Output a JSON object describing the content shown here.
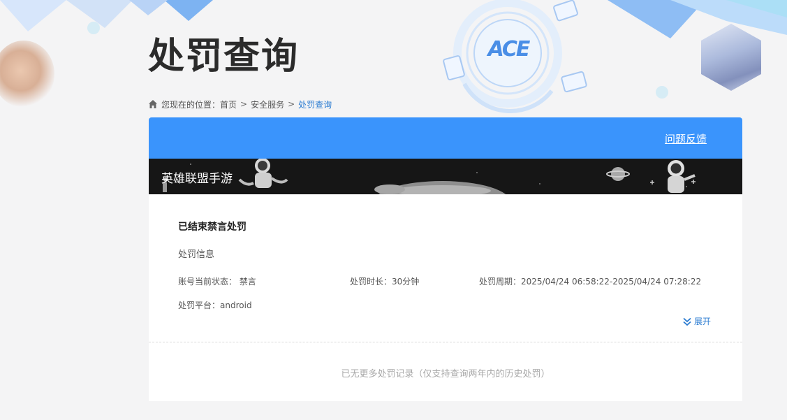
{
  "header": {
    "logo_text": "ACE",
    "title": "处罚查询"
  },
  "breadcrumb": {
    "prefix": "您现在的位置：",
    "items": [
      "首页",
      "安全服务"
    ],
    "separator": ">",
    "current": "处罚查询"
  },
  "card": {
    "feedback_label": "问题反馈",
    "game_name": "英雄联盟手游",
    "record": {
      "title": "已结束禁言处罚",
      "section_label": "处罚信息",
      "status_label": "账号当前状态：",
      "status_value": "禁言",
      "duration_label": "处罚时长：",
      "duration_value": "30分钟",
      "period_label": "处罚周期：",
      "period_value": "2025/04/24 06:58:22-2025/04/24 07:28:22",
      "platform_label": "处罚平台：",
      "platform_value": "android",
      "expand_label": "展开"
    },
    "no_more_text": "已无更多处罚记录（仅支持查询两年内的历史处罚）"
  },
  "colors": {
    "accent": "#3a94fc",
    "link": "#2a7bd1",
    "banner_bg": "#161616"
  },
  "icons": {
    "breadcrumb_home": "home-icon",
    "expand": "double-chevron-down-icon"
  }
}
